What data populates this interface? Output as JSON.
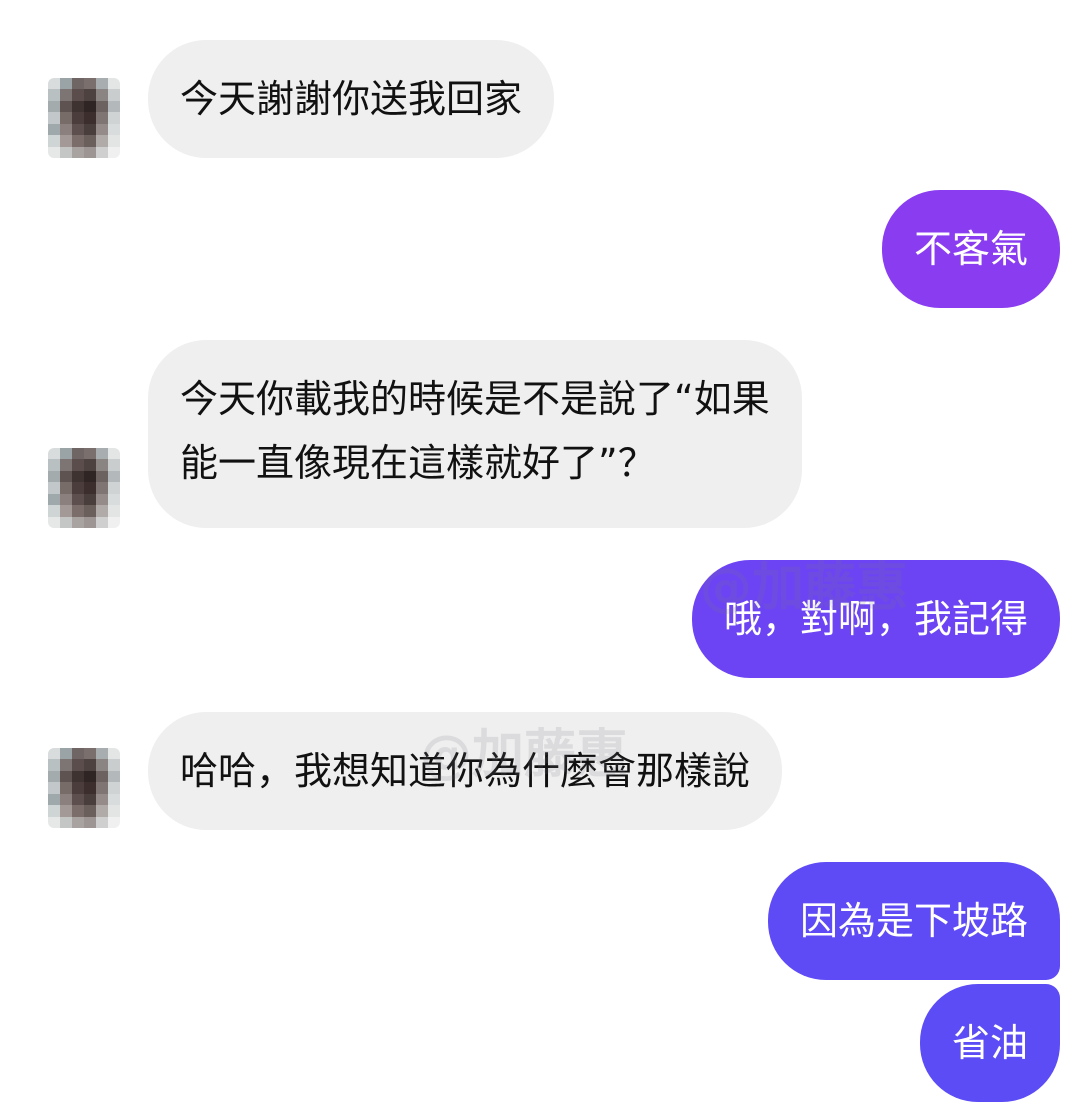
{
  "colors": {
    "incoming_bubble": "#efefef",
    "outgoing_gradient_top": "#8a3df0",
    "outgoing_gradient_mid": "#6a46f3",
    "outgoing_gradient_bottom": "#5b4cf5"
  },
  "messages": [
    {
      "direction": "in",
      "text": "今天謝謝你送我回家"
    },
    {
      "direction": "out",
      "text": "不客氣"
    },
    {
      "direction": "in",
      "lines": [
        "今天你載我的時候是不是說了“如果",
        "能一直像現在這樣就好了”？"
      ]
    },
    {
      "direction": "out",
      "text": "哦，對啊，我記得"
    },
    {
      "direction": "in",
      "text": "哈哈，我想知道你為什麼會那樣說"
    },
    {
      "direction": "out",
      "text": "因為是下坡路"
    },
    {
      "direction": "out",
      "text": "省油"
    }
  ],
  "watermark": "@加藤惠"
}
